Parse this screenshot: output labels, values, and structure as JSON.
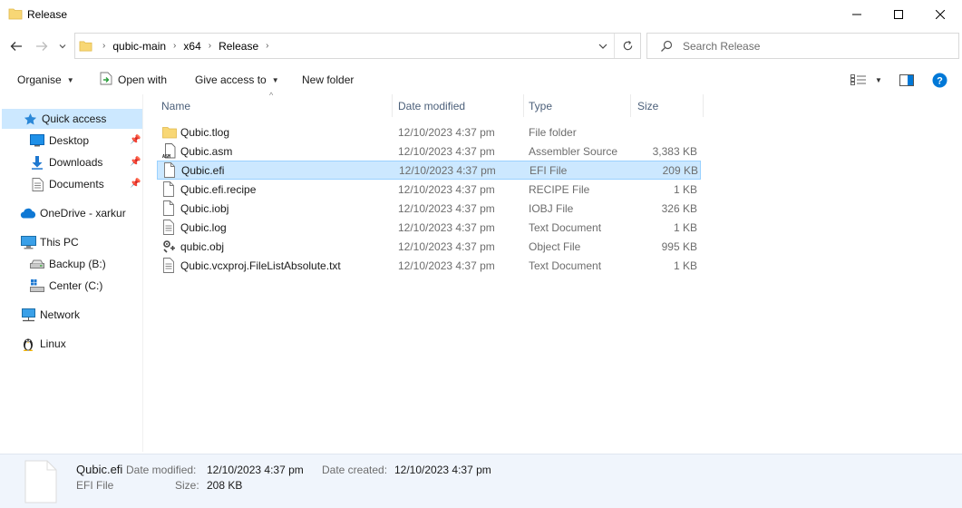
{
  "window": {
    "title": "Release",
    "minimize_label": "",
    "maximize_label": "",
    "close_label": ""
  },
  "address": {
    "crumbs": [
      "qubic-main",
      "x64",
      "Release"
    ]
  },
  "search": {
    "placeholder": "Search Release"
  },
  "toolbar": {
    "organise": "Organise",
    "open_with": "Open with",
    "give_access": "Give access to",
    "new_folder": "New folder"
  },
  "sidebar": {
    "items": [
      {
        "label": "Quick access",
        "icon": "star-icon",
        "selected": true
      },
      {
        "label": "Desktop",
        "icon": "desktop-icon",
        "pinned": true
      },
      {
        "label": "Downloads",
        "icon": "download-icon",
        "pinned": true
      },
      {
        "label": "Documents",
        "icon": "document-icon",
        "pinned": true
      },
      {
        "label": "OneDrive - xarkur",
        "icon": "cloud-icon"
      },
      {
        "label": "This PC",
        "icon": "computer-icon"
      },
      {
        "label": "Backup (B:)",
        "icon": "drive-icon"
      },
      {
        "label": "Center (C:)",
        "icon": "windows-drive-icon"
      },
      {
        "label": "Network",
        "icon": "network-icon"
      },
      {
        "label": "Linux",
        "icon": "penguin-icon"
      }
    ]
  },
  "columns": {
    "name": "Name",
    "date": "Date modified",
    "type": "Type",
    "size": "Size"
  },
  "files": [
    {
      "name": "Qubic.tlog",
      "date": "12/10/2023 4:37 pm",
      "type": "File folder",
      "size": "",
      "icon": "folder-icon"
    },
    {
      "name": "Qubic.asm",
      "date": "12/10/2023 4:37 pm",
      "type": "Assembler Source",
      "size": "3,383 KB",
      "icon": "asm-file-icon"
    },
    {
      "name": "Qubic.efi",
      "date": "12/10/2023 4:37 pm",
      "type": "EFI File",
      "size": "209 KB",
      "icon": "blank-file-icon",
      "selected": true
    },
    {
      "name": "Qubic.efi.recipe",
      "date": "12/10/2023 4:37 pm",
      "type": "RECIPE File",
      "size": "1 KB",
      "icon": "blank-file-icon"
    },
    {
      "name": "Qubic.iobj",
      "date": "12/10/2023 4:37 pm",
      "type": "IOBJ File",
      "size": "326 KB",
      "icon": "blank-file-icon"
    },
    {
      "name": "Qubic.log",
      "date": "12/10/2023 4:37 pm",
      "type": "Text Document",
      "size": "1 KB",
      "icon": "text-file-icon"
    },
    {
      "name": "qubic.obj",
      "date": "12/10/2023 4:37 pm",
      "type": "Object File",
      "size": "995 KB",
      "icon": "object-file-icon"
    },
    {
      "name": "Qubic.vcxproj.FileListAbsolute.txt",
      "date": "12/10/2023 4:37 pm",
      "type": "Text Document",
      "size": "1 KB",
      "icon": "text-file-icon"
    }
  ],
  "details": {
    "name": "Qubic.efi",
    "type": "EFI File",
    "modified_label": "Date modified:",
    "modified_value": "12/10/2023 4:37 pm",
    "created_label": "Date created:",
    "created_value": "12/10/2023 4:37 pm",
    "size_label": "Size:",
    "size_value": "208 KB"
  },
  "colors": {
    "selection": "#cce8ff",
    "selection_border": "#99d1ff",
    "folder": "#f8d775",
    "accent": "#0078d7"
  }
}
